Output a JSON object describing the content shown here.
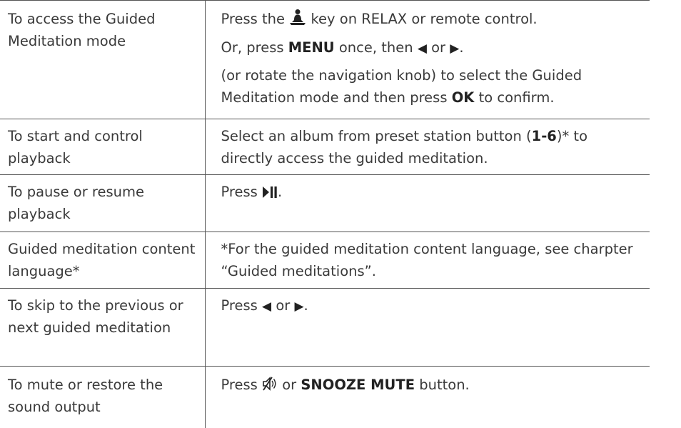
{
  "rows": [
    {
      "action": "To access the Guided Meditation mode",
      "l1_pre": "Press the",
      "l1_post": "key on RELAX or remote control.",
      "l2_pre": "Or, press",
      "l2_menu": "MENU",
      "l2_mid": "once, then",
      "l2_or": "or",
      "l2_end": ".",
      "l3_pre": "(or rotate the navigation knob) to select the Guided Meditation mode and then press",
      "l3_ok": "OK",
      "l3_post": "to confirm."
    },
    {
      "action": "To start and control playback",
      "pre": "Select an album from preset station button (",
      "bold": "1-6",
      "post": ")* to directly access the guided meditation."
    },
    {
      "action": "To pause or resume playback",
      "pre": "Press",
      "post": "."
    },
    {
      "action": "Guided meditation content language*",
      "text": "*For the guided meditation content language, see charpter “Guided meditations”."
    },
    {
      "action": "To skip to the previous or next guided meditation",
      "pre": "Press",
      "or": "or",
      "end": "."
    },
    {
      "action": "To mute or restore the sound output",
      "pre": "Press",
      "mid": "or",
      "bold": "SNOOZE MUTE",
      "post": "button."
    }
  ],
  "icons": [
    "meditation-icon",
    "left-triangle-icon",
    "right-triangle-icon",
    "play-pause-icon",
    "mute-icon"
  ]
}
